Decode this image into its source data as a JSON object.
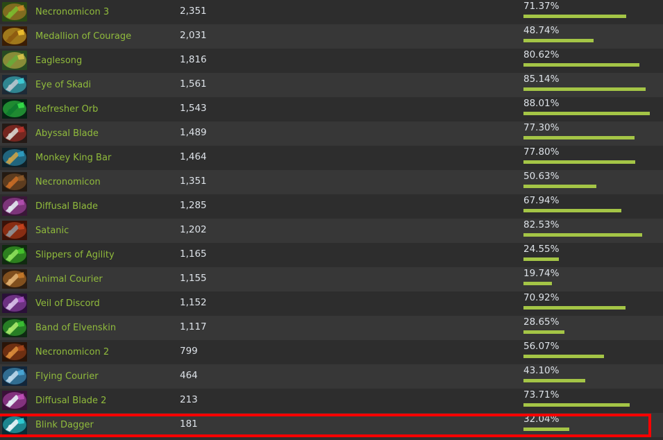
{
  "table": {
    "column_names": [
      "item-icon",
      "item-name",
      "count",
      "percentage"
    ],
    "bar_color": "#a4c546",
    "name_color": "#90bb3c",
    "value_color": "#dde2e8",
    "row_bg_odd": "#2d2d2d",
    "row_bg_even": "#373737",
    "rows": [
      {
        "icon": "necronomicon-3-icon",
        "name": "Necronomicon 3",
        "count": "2,351",
        "pct_label": "71.37%",
        "pct": 71.37,
        "icon_colors": [
          "#2b4a14",
          "#c6892a",
          "#7cb82f"
        ]
      },
      {
        "icon": "medallion-of-courage-icon",
        "name": "Medallion of Courage",
        "count": "2,031",
        "pct_label": "48.74%",
        "pct": 48.74,
        "icon_colors": [
          "#3a1d05",
          "#f2c230",
          "#8c5a10"
        ]
      },
      {
        "icon": "eaglesong-icon",
        "name": "Eaglesong",
        "count": "1,816",
        "pct_label": "80.62%",
        "pct": 80.62,
        "icon_colors": [
          "#274a22",
          "#d8c34a",
          "#6aa83a"
        ]
      },
      {
        "icon": "eye-of-skadi-icon",
        "name": "Eye of Skadi",
        "count": "1,561",
        "pct_label": "85.14%",
        "pct": 85.14,
        "icon_colors": [
          "#1d2a36",
          "#3fd0da",
          "#b7c6ce"
        ]
      },
      {
        "icon": "refresher-orb-icon",
        "name": "Refresher Orb",
        "count": "1,543",
        "pct_label": "88.01%",
        "pct": 88.01,
        "icon_colors": [
          "#062213",
          "#35e04a",
          "#0f7a2e"
        ]
      },
      {
        "icon": "abyssal-blade-icon",
        "name": "Abyssal Blade",
        "count": "1,489",
        "pct_label": "77.30%",
        "pct": 77.3,
        "icon_colors": [
          "#241a16",
          "#b8332a",
          "#d6d2cb"
        ]
      },
      {
        "icon": "monkey-king-bar-icon",
        "name": "Monkey King Bar",
        "count": "1,464",
        "pct_label": "77.80%",
        "pct": 77.8,
        "icon_colors": [
          "#102026",
          "#2f9ec4",
          "#c8a24a"
        ]
      },
      {
        "icon": "necronomicon-icon",
        "name": "Necronomicon",
        "count": "1,351",
        "pct_label": "50.63%",
        "pct": 50.63,
        "icon_colors": [
          "#241a12",
          "#8d5a2a",
          "#c46b26"
        ]
      },
      {
        "icon": "diffusal-blade-icon",
        "name": "Diffusal Blade",
        "count": "1,285",
        "pct_label": "67.94%",
        "pct": 67.94,
        "icon_colors": [
          "#3a1738",
          "#b44fb0",
          "#e2e6ee"
        ]
      },
      {
        "icon": "satanic-icon",
        "name": "Satanic",
        "count": "1,202",
        "pct_label": "82.53%",
        "pct": 82.53,
        "icon_colors": [
          "#3a1208",
          "#c8441e",
          "#8e8e92"
        ]
      },
      {
        "icon": "slippers-of-agility-icon",
        "name": "Slippers of Agility",
        "count": "1,165",
        "pct_label": "24.55%",
        "pct": 24.55,
        "icon_colors": [
          "#102a10",
          "#46c62c",
          "#8ce05a"
        ]
      },
      {
        "icon": "animal-courier-icon",
        "name": "Animal Courier",
        "count": "1,155",
        "pct_label": "19.74%",
        "pct": 19.74,
        "icon_colors": [
          "#2a1c10",
          "#c67a2a",
          "#e0b070"
        ]
      },
      {
        "icon": "veil-of-discord-icon",
        "name": "Veil of Discord",
        "count": "1,152",
        "pct_label": "70.92%",
        "pct": 70.92,
        "icon_colors": [
          "#2a1038",
          "#a44fc0",
          "#d8c0e8"
        ]
      },
      {
        "icon": "band-of-elvenskin-icon",
        "name": "Band of Elvenskin",
        "count": "1,117",
        "pct_label": "28.65%",
        "pct": 28.65,
        "icon_colors": [
          "#0e2a12",
          "#3cc234",
          "#a8e86a"
        ]
      },
      {
        "icon": "necronomicon-2-icon",
        "name": "Necronomicon 2",
        "count": "799",
        "pct_label": "56.07%",
        "pct": 56.07,
        "icon_colors": [
          "#2a1408",
          "#a4461c",
          "#d88a3a"
        ]
      },
      {
        "icon": "flying-courier-icon",
        "name": "Flying Courier",
        "count": "464",
        "pct_label": "43.10%",
        "pct": 43.1,
        "icon_colors": [
          "#12263a",
          "#4aa8d8",
          "#bcd8ea"
        ]
      },
      {
        "icon": "diffusal-blade-2-icon",
        "name": "Diffusal Blade 2",
        "count": "213",
        "pct_label": "73.71%",
        "pct": 73.71,
        "icon_colors": [
          "#3a1038",
          "#c04fb8",
          "#e8eef6"
        ]
      },
      {
        "icon": "blink-dagger-icon",
        "name": "Blink Dagger",
        "count": "181",
        "pct_label": "32.04%",
        "pct": 32.04,
        "icon_colors": [
          "#0a2a34",
          "#2fd0d8",
          "#e8f4f8"
        ]
      }
    ]
  },
  "annotation": {
    "highlight_box_color": "#fd0000",
    "highlighted_row_name": "Blink Dagger"
  }
}
